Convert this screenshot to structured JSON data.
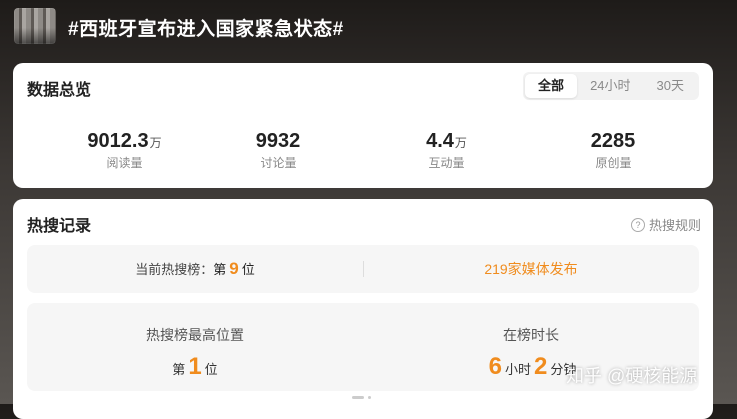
{
  "topic": {
    "title": "#西班牙宣布进入国家紧急状态#"
  },
  "overview": {
    "title": "数据总览",
    "tabs": [
      {
        "label": "全部",
        "active": true
      },
      {
        "label": "24小时",
        "active": false
      },
      {
        "label": "30天",
        "active": false
      }
    ],
    "metrics": [
      {
        "value": "9012.3",
        "unit": "万",
        "label": "阅读量"
      },
      {
        "value": "9932",
        "unit": "",
        "label": "讨论量"
      },
      {
        "value": "4.4",
        "unit": "万",
        "label": "互动量"
      },
      {
        "value": "2285",
        "unit": "",
        "label": "原创量"
      }
    ]
  },
  "record": {
    "title": "热搜记录",
    "rules_label": "热搜规则",
    "rules_icon": "?",
    "current_rank": {
      "prefix": "当前热搜榜：",
      "pre": "第",
      "value": "9",
      "post": "位"
    },
    "media_publish": "219家媒体发布",
    "peak": {
      "label": "热搜榜最高位置",
      "pre": "第",
      "value": "1",
      "post": "位"
    },
    "duration": {
      "label": "在榜时长",
      "hours": "6",
      "hours_unit": "小时",
      "minutes": "2",
      "minutes_unit": "分钟"
    }
  },
  "watermark": "知乎 @硬核能源",
  "colors": {
    "accent": "#f08c1e",
    "text_dark": "#222222",
    "text_muted": "#888888",
    "card_bg": "#ffffff",
    "box_bg": "#f6f6f6"
  }
}
